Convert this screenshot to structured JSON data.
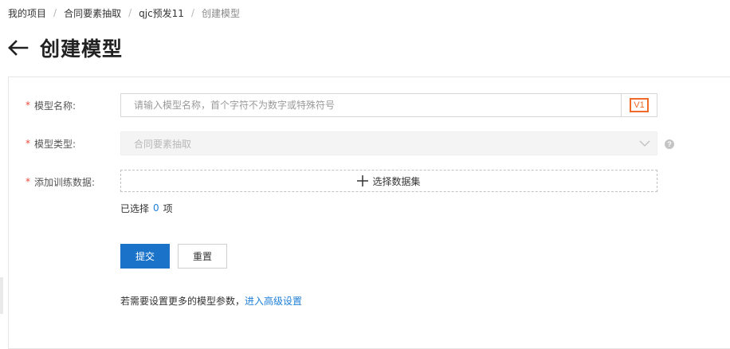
{
  "breadcrumb": {
    "items": [
      "我的项目",
      "合同要素抽取",
      "qjc预发11"
    ],
    "current": "创建模型",
    "separator": "/"
  },
  "page": {
    "title": "创建模型"
  },
  "form": {
    "required_mark": "*",
    "model_name": {
      "label": "模型名称:",
      "value": "",
      "placeholder": "请输入模型名称，首个字符不为数字或特殊符号",
      "version": "V1"
    },
    "model_type": {
      "label": "模型类型:",
      "selected": "合同要素抽取",
      "help_glyph": "?"
    },
    "training_data": {
      "label": "添加训练数据:",
      "button_label": "选择数据集",
      "selected_prefix": "已选择",
      "selected_count": "0",
      "selected_suffix": "项"
    },
    "submit_label": "提交",
    "reset_label": "重置",
    "advanced_hint": "若需要设置更多的模型参数，",
    "advanced_link": "进入高级设置"
  },
  "colors": {
    "primary": "#1a73c8",
    "required": "#e84b3c",
    "version_badge": "#f06a2a",
    "link": "#1f7fd6"
  },
  "icons": [
    "back-arrow-icon",
    "chevron-down-icon",
    "help-icon",
    "plus-icon"
  ]
}
